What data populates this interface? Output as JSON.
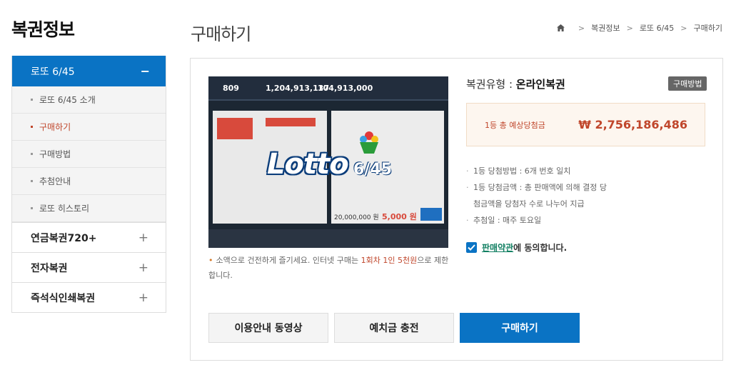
{
  "sidebar": {
    "title": "복권정보",
    "active": {
      "label": "로또 6/45",
      "toggle": "−"
    },
    "sub_items": [
      {
        "label": "로또 6/45 소개",
        "current": false
      },
      {
        "label": "구매하기",
        "current": true
      },
      {
        "label": "구매방법",
        "current": false
      },
      {
        "label": "추첨안내",
        "current": false
      },
      {
        "label": "로또 히스토리",
        "current": false
      }
    ],
    "items": [
      {
        "label": "연금복권720+",
        "toggle": "+"
      },
      {
        "label": "전자복권",
        "toggle": "+"
      },
      {
        "label": "즉석식인쇄복권",
        "toggle": "+"
      }
    ]
  },
  "header": {
    "title": "구매하기",
    "breadcrumb": [
      "복권정보",
      "로또 6/45",
      "구매하기"
    ]
  },
  "game_image": {
    "logo_main": "Lotto",
    "logo_sub": "6/45",
    "round": "809",
    "amount_1": "1,204,913,137",
    "amount_2": "104,913,000",
    "amount_3": "20,000,000 원",
    "amount_4": "5,000 원"
  },
  "notice": {
    "prefix": "소액으로 건전하게 즐기세요. 인터넷 구매는 ",
    "highlight": "1회차 1인 5천원",
    "suffix": "으로 제한합니다."
  },
  "product": {
    "type_label": "복권유형 : ",
    "type_value": "온라인복권",
    "how_button": "구매방법",
    "prize_label": "1등 총 예상당첨금",
    "prize_value": "₩ 2,756,186,486",
    "info": [
      "1등 당첨방법 : 6개 번호 일치",
      "1등 당첨금액 : 총 판매액에 의해 결정 당첨금액을 당첨자 수로 나누어 지급",
      "추첨일 : 매주 토요일"
    ],
    "agree_link": "판매약관",
    "agree_text": "에 동의합니다."
  },
  "buttons": {
    "video": "이용안내 동영상",
    "charge": "예치금 충전",
    "buy": "구매하기"
  },
  "colors": {
    "accent": "#0a73c4",
    "highlight": "#c0462b",
    "link": "#138063"
  }
}
